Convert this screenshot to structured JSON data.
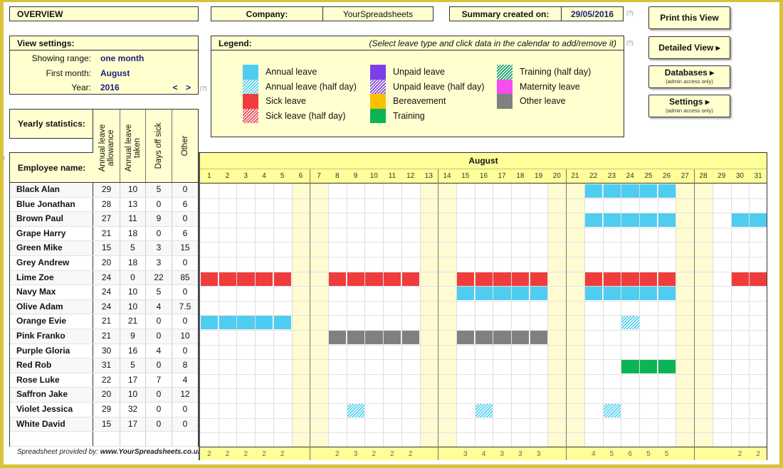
{
  "header": {
    "overview_label": "OVERVIEW",
    "company_label": "Company:",
    "company_value": "YourSpreadsheets",
    "summary_label": "Summary created on:",
    "summary_value": "29/05/2016",
    "help_marker": "(?)"
  },
  "view_settings": {
    "title": "View settings:",
    "showing_range_label": "Showing range:",
    "showing_range_value": "one month",
    "first_month_label": "First month:",
    "first_month_value": "August",
    "year_label": "Year:",
    "year_value": "2016",
    "prev_label": "<",
    "next_label": ">"
  },
  "legend": {
    "title": "Legend:",
    "instruction": "(Select leave type and click data in the calendar to add/remove it)",
    "items": [
      {
        "key": "annual",
        "label": "Annual leave",
        "color": "#4fcdf0",
        "style": "solid"
      },
      {
        "key": "annual_half",
        "label": "Annual leave (half day)",
        "color": "#4fcdf0",
        "style": "hatch"
      },
      {
        "key": "sick",
        "label": "Sick leave",
        "color": "#f03c3c",
        "style": "solid"
      },
      {
        "key": "sick_half",
        "label": "Sick leave (half day)",
        "color": "#e8404a",
        "style": "hatch"
      },
      {
        "key": "unpaid",
        "label": "Unpaid leave",
        "color": "#7b3fe8",
        "style": "solid"
      },
      {
        "key": "unpaid_half",
        "label": "Unpaid leave (half day)",
        "color": "#7b3fd8",
        "style": "hatch"
      },
      {
        "key": "bereavement",
        "label": "Bereavement",
        "color": "#fdc000",
        "style": "solid"
      },
      {
        "key": "training",
        "label": "Training",
        "color": "#0db456",
        "style": "solid"
      },
      {
        "key": "training_half",
        "label": "Training (half day)",
        "color": "#0d9b5a",
        "style": "hatch"
      },
      {
        "key": "maternity",
        "label": "Maternity leave",
        "color": "#f64cf0",
        "style": "solid"
      },
      {
        "key": "other",
        "label": "Other leave",
        "color": "#808080",
        "style": "solid"
      }
    ]
  },
  "buttons": {
    "print": "Print this View",
    "detailed": "Detailed View ▸",
    "databases": "Databases ▸",
    "databases_sub": "(admin access only)",
    "settings": "Settings ▸",
    "settings_sub": "(admin access only)"
  },
  "stats": {
    "yearly_label": "Yearly statistics:",
    "employee_label": "Employee name:",
    "columns": [
      "Annual leave allowance",
      "Annual leave taken",
      "Days off sick",
      "Other"
    ]
  },
  "employees": [
    {
      "name": "Black Alan",
      "allowance": "29",
      "taken": "10",
      "sick": "5",
      "other": "0",
      "leave": [
        {
          "type": "annual",
          "days": [
            22,
            23,
            24,
            25,
            26
          ]
        }
      ]
    },
    {
      "name": "Blue Jonathan",
      "allowance": "28",
      "taken": "13",
      "sick": "0",
      "other": "6",
      "leave": []
    },
    {
      "name": "Brown Paul",
      "allowance": "27",
      "taken": "11",
      "sick": "9",
      "other": "0",
      "leave": [
        {
          "type": "annual",
          "days": [
            22,
            23,
            24,
            25,
            26,
            30,
            31
          ]
        }
      ]
    },
    {
      "name": "Grape Harry",
      "allowance": "21",
      "taken": "18",
      "sick": "0",
      "other": "6",
      "leave": []
    },
    {
      "name": "Green Mike",
      "allowance": "15",
      "taken": "5",
      "sick": "3",
      "other": "15",
      "leave": []
    },
    {
      "name": "Grey Andrew",
      "allowance": "20",
      "taken": "18",
      "sick": "3",
      "other": "0",
      "leave": []
    },
    {
      "name": "Lime Zoe",
      "allowance": "24",
      "taken": "0",
      "sick": "22",
      "other": "85",
      "leave": [
        {
          "type": "sick",
          "days": [
            1,
            2,
            3,
            4,
            5,
            8,
            9,
            10,
            11,
            12,
            15,
            16,
            17,
            18,
            19,
            22,
            23,
            24,
            25,
            26,
            30,
            31
          ]
        }
      ]
    },
    {
      "name": "Navy Max",
      "allowance": "24",
      "taken": "10",
      "sick": "5",
      "other": "0",
      "leave": [
        {
          "type": "annual",
          "days": [
            15,
            16,
            17,
            18,
            19,
            22,
            23,
            24,
            25,
            26
          ]
        }
      ]
    },
    {
      "name": "Olive Adam",
      "allowance": "24",
      "taken": "10",
      "sick": "4",
      "other": "7.5",
      "leave": []
    },
    {
      "name": "Orange Evie",
      "allowance": "21",
      "taken": "21",
      "sick": "0",
      "other": "0",
      "leave": [
        {
          "type": "annual",
          "days": [
            1,
            2,
            3,
            4,
            5
          ]
        },
        {
          "type": "annual_half",
          "days": [
            24
          ]
        }
      ]
    },
    {
      "name": "Pink Franko",
      "allowance": "21",
      "taken": "9",
      "sick": "0",
      "other": "10",
      "leave": [
        {
          "type": "other",
          "days": [
            8,
            9,
            10,
            11,
            12,
            15,
            16,
            17,
            18,
            19
          ]
        }
      ]
    },
    {
      "name": "Purple Gloria",
      "allowance": "30",
      "taken": "16",
      "sick": "4",
      "other": "0",
      "leave": []
    },
    {
      "name": "Red Rob",
      "allowance": "31",
      "taken": "5",
      "sick": "0",
      "other": "8",
      "leave": [
        {
          "type": "training",
          "days": [
            24,
            25,
            26
          ]
        }
      ]
    },
    {
      "name": "Rose Luke",
      "allowance": "22",
      "taken": "17",
      "sick": "7",
      "other": "4",
      "leave": []
    },
    {
      "name": "Saffron Jake",
      "allowance": "20",
      "taken": "10",
      "sick": "0",
      "other": "12",
      "leave": []
    },
    {
      "name": "Violet Jessica",
      "allowance": "29",
      "taken": "32",
      "sick": "0",
      "other": "0",
      "leave": [
        {
          "type": "annual_half",
          "days": [
            9,
            16,
            23
          ]
        }
      ]
    },
    {
      "name": "White David",
      "allowance": "15",
      "taken": "17",
      "sick": "0",
      "other": "0",
      "leave": []
    }
  ],
  "calendar": {
    "month": "August",
    "days": [
      1,
      2,
      3,
      4,
      5,
      6,
      7,
      8,
      9,
      10,
      11,
      12,
      13,
      14,
      15,
      16,
      17,
      18,
      19,
      20,
      21,
      22,
      23,
      24,
      25,
      26,
      27,
      28,
      29,
      30,
      31
    ],
    "weekends": [
      6,
      7,
      13,
      14,
      20,
      21,
      27,
      28
    ],
    "week_separators_after": [
      6,
      13,
      20,
      27
    ],
    "totals": [
      "2",
      "2",
      "2",
      "2",
      "2",
      "",
      "",
      "2",
      "3",
      "2",
      "2",
      "2",
      "",
      "",
      "3",
      "4",
      "3",
      "3",
      "3",
      "",
      "",
      "4",
      "5",
      "6",
      "5",
      "5",
      "",
      "",
      "",
      "2",
      "2"
    ]
  },
  "footer": {
    "provided_by": "Spreadsheet provided by:",
    "provided_url": "www.YourSpreadsheets.co.uk"
  }
}
